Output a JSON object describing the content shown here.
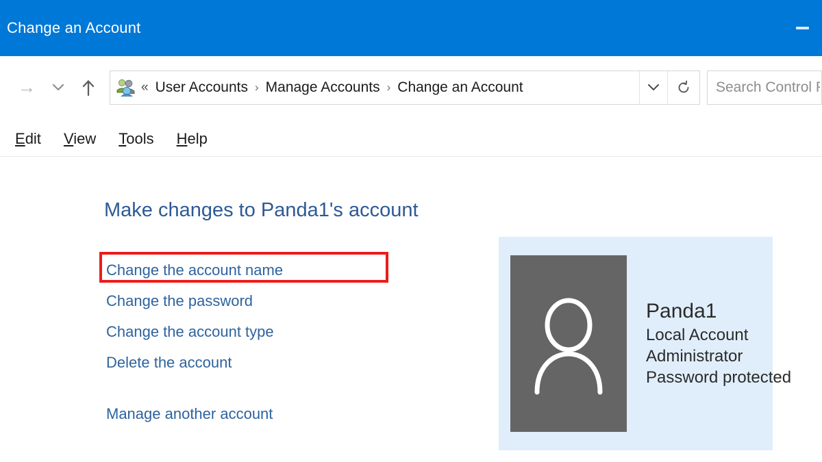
{
  "window": {
    "title": "Change an Account",
    "accent_color": "#0078d7",
    "minimize_label": "Minimize"
  },
  "navbar": {
    "back_icon": "arrow-left-icon",
    "forward_icon": "arrow-right-icon",
    "recent_icon": "chevron-down-icon",
    "up_icon": "arrow-up-icon",
    "breadcrumb_icon": "user-accounts-icon",
    "overflow": "«",
    "breadcrumbs": [
      {
        "label": "User Accounts"
      },
      {
        "label": "Manage Accounts"
      },
      {
        "label": "Change an Account"
      }
    ],
    "separator": "›",
    "dropdown_icon": "chevron-down-icon",
    "refresh_icon": "refresh-icon",
    "search": {
      "placeholder": "Search Control Panel",
      "value": ""
    }
  },
  "menubar": {
    "items": [
      {
        "accel": "E",
        "rest": "dit"
      },
      {
        "accel": "V",
        "rest": "iew"
      },
      {
        "accel": "T",
        "rest": "ools"
      },
      {
        "accel": "H",
        "rest": "elp"
      }
    ]
  },
  "main": {
    "heading": "Make changes to Panda1's account",
    "links": [
      {
        "label": "Change the account name",
        "highlighted": true
      },
      {
        "label": "Change the password",
        "highlighted": false
      },
      {
        "label": "Change the account type",
        "highlighted": false
      },
      {
        "label": "Delete the account",
        "highlighted": false
      },
      {
        "label": "Manage another account",
        "highlighted": false
      }
    ],
    "highlight_color": "#ec1c1c",
    "link_color": "#2e639e",
    "heading_color": "#2d5a96"
  },
  "account_panel": {
    "background_color": "#e0eefb",
    "avatar_color": "#656565",
    "avatar_icon": "user-avatar-icon",
    "name": "Panda1",
    "details": [
      "Local Account",
      "Administrator",
      "Password protected"
    ]
  }
}
